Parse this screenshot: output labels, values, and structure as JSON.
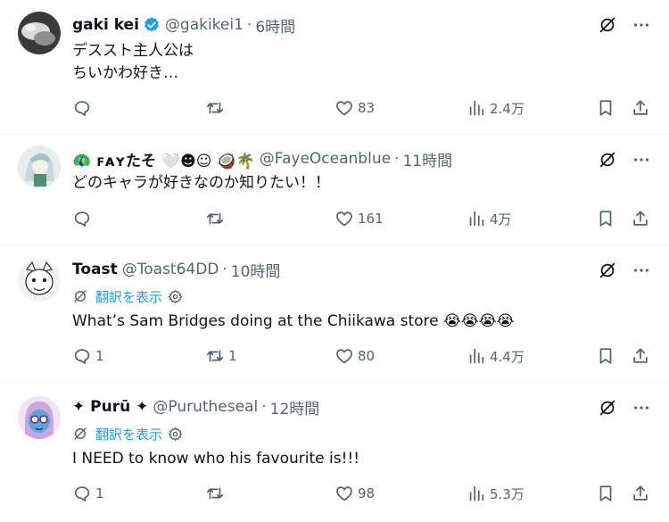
{
  "tweets": [
    {
      "name": "gaki kei",
      "verified": true,
      "handle": "@gakikei1",
      "dot": "·",
      "time": "6時間",
      "text_lines": [
        "デススト主人公は",
        "ちいかわ好き…"
      ],
      "replies": "",
      "retweets": "",
      "likes": "83",
      "views": "2.4万"
    },
    {
      "name": "🦚 ꜰᴀʏたそ 🤍☻☺ 🥥🌴",
      "verified": false,
      "handle": "@FayeOceanblue",
      "dot": "·",
      "time": "11時間",
      "text_lines": [
        "どのキャラが好きなのか知りたい！！"
      ],
      "replies": "",
      "retweets": "",
      "likes": "161",
      "views": "4万"
    },
    {
      "name": "Toast",
      "verified": false,
      "handle": "@Toast64DD",
      "dot": "·",
      "time": "10時間",
      "translate_label": "翻訳を表示",
      "text_lines": [
        "What’s Sam Bridges doing at the Chiikawa store 😭😭😭😭"
      ],
      "replies": "1",
      "retweets": "1",
      "likes": "80",
      "views": "4.4万"
    },
    {
      "name": "✦ Purū ✦",
      "verified": false,
      "handle": "@Purutheseal",
      "dot": "·",
      "time": "12時間",
      "translate_label": "翻訳を表示",
      "text_lines": [
        "I NEED to know who his favourite is!!!"
      ],
      "replies": "1",
      "retweets": "",
      "likes": "98",
      "views": "5.3万"
    }
  ],
  "icons": {
    "verified": "verified-badge-icon",
    "grok": "grok-icon",
    "more": "more-icon",
    "reply": "reply-icon",
    "retweet": "retweet-icon",
    "like": "like-icon",
    "views": "views-icon",
    "bookmark": "bookmark-icon",
    "share": "share-icon",
    "translate": "translate-icon",
    "settings": "gear-icon"
  },
  "colors": {
    "text": "#0f1419",
    "secondary": "#536471",
    "accent": "#1d9bf0",
    "divider": "#eff3f4"
  }
}
